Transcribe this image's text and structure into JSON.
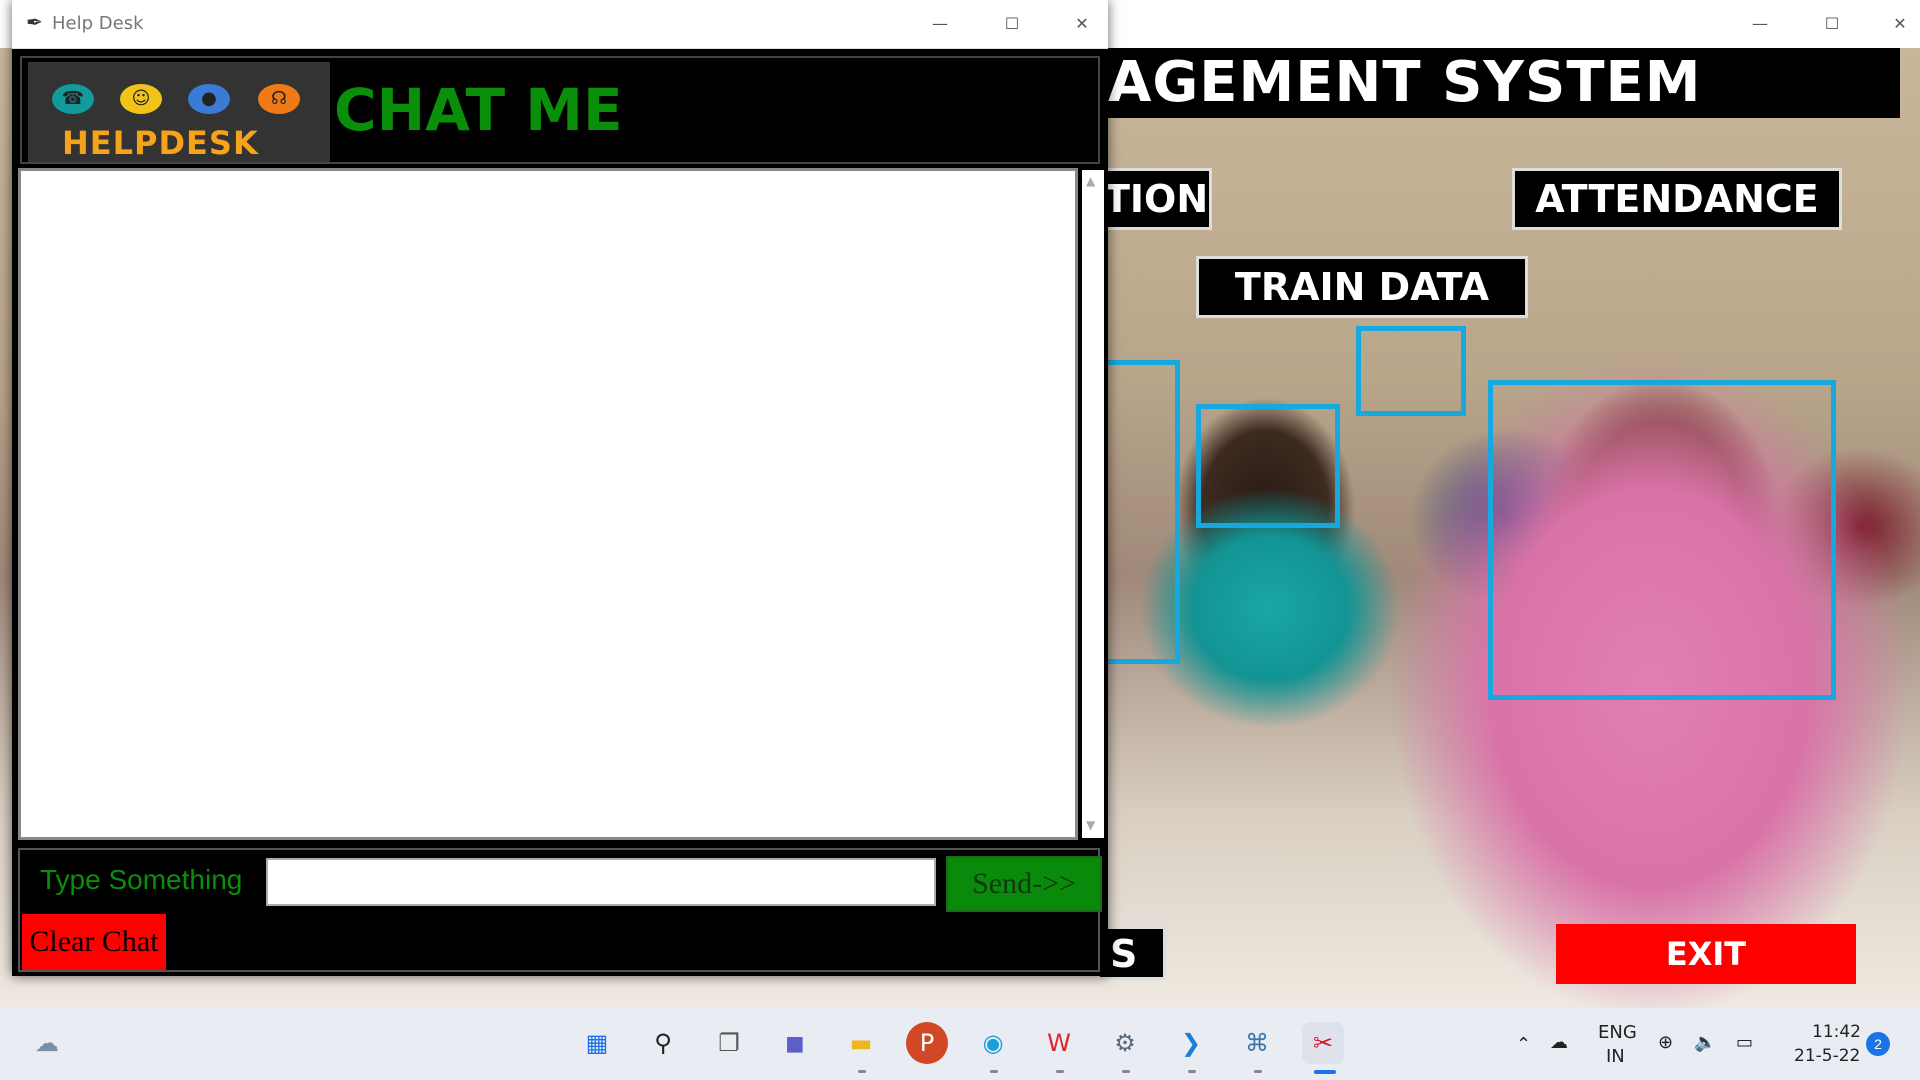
{
  "bg_window": {
    "header_text": "AGEMENT SYSTEM",
    "buttons": {
      "tion": "TION",
      "attendance": "ATTENDANCE",
      "train_data": "TRAIN DATA",
      "s": "S",
      "exit": "EXIT"
    },
    "controls": {
      "minimize": "—",
      "maximize": "☐",
      "close": "✕"
    }
  },
  "helpdesk": {
    "title": "Help Desk",
    "controls": {
      "minimize": "—",
      "maximize": "☐",
      "close": "✕"
    },
    "logo_text": "HELPDESK",
    "heading": "CHAT ME",
    "chat_log": "",
    "type_label": "Type Something",
    "input_value": "",
    "send_label": "Send->>",
    "clear_label": "Clear Chat",
    "scroll_up": "▲",
    "scroll_down": "▼"
  },
  "taskbar": {
    "language": "ENG",
    "region": "IN",
    "time": "11:42",
    "date": "21-5-22",
    "notification_count": "2",
    "icons": [
      "weather-icon",
      "start-icon",
      "search-icon",
      "task-view-icon",
      "teams-icon",
      "file-explorer-icon",
      "powerpoint-icon",
      "edge-icon",
      "wps-icon",
      "settings-icon",
      "vscode-icon",
      "python-icon",
      "snipping-tool-icon"
    ]
  },
  "colors": {
    "chat_me_green": "#0a8f0a",
    "helpdesk_orange": "#f4a31a",
    "exit_red": "#ff0000",
    "face_box_blue": "#18a8e0"
  }
}
